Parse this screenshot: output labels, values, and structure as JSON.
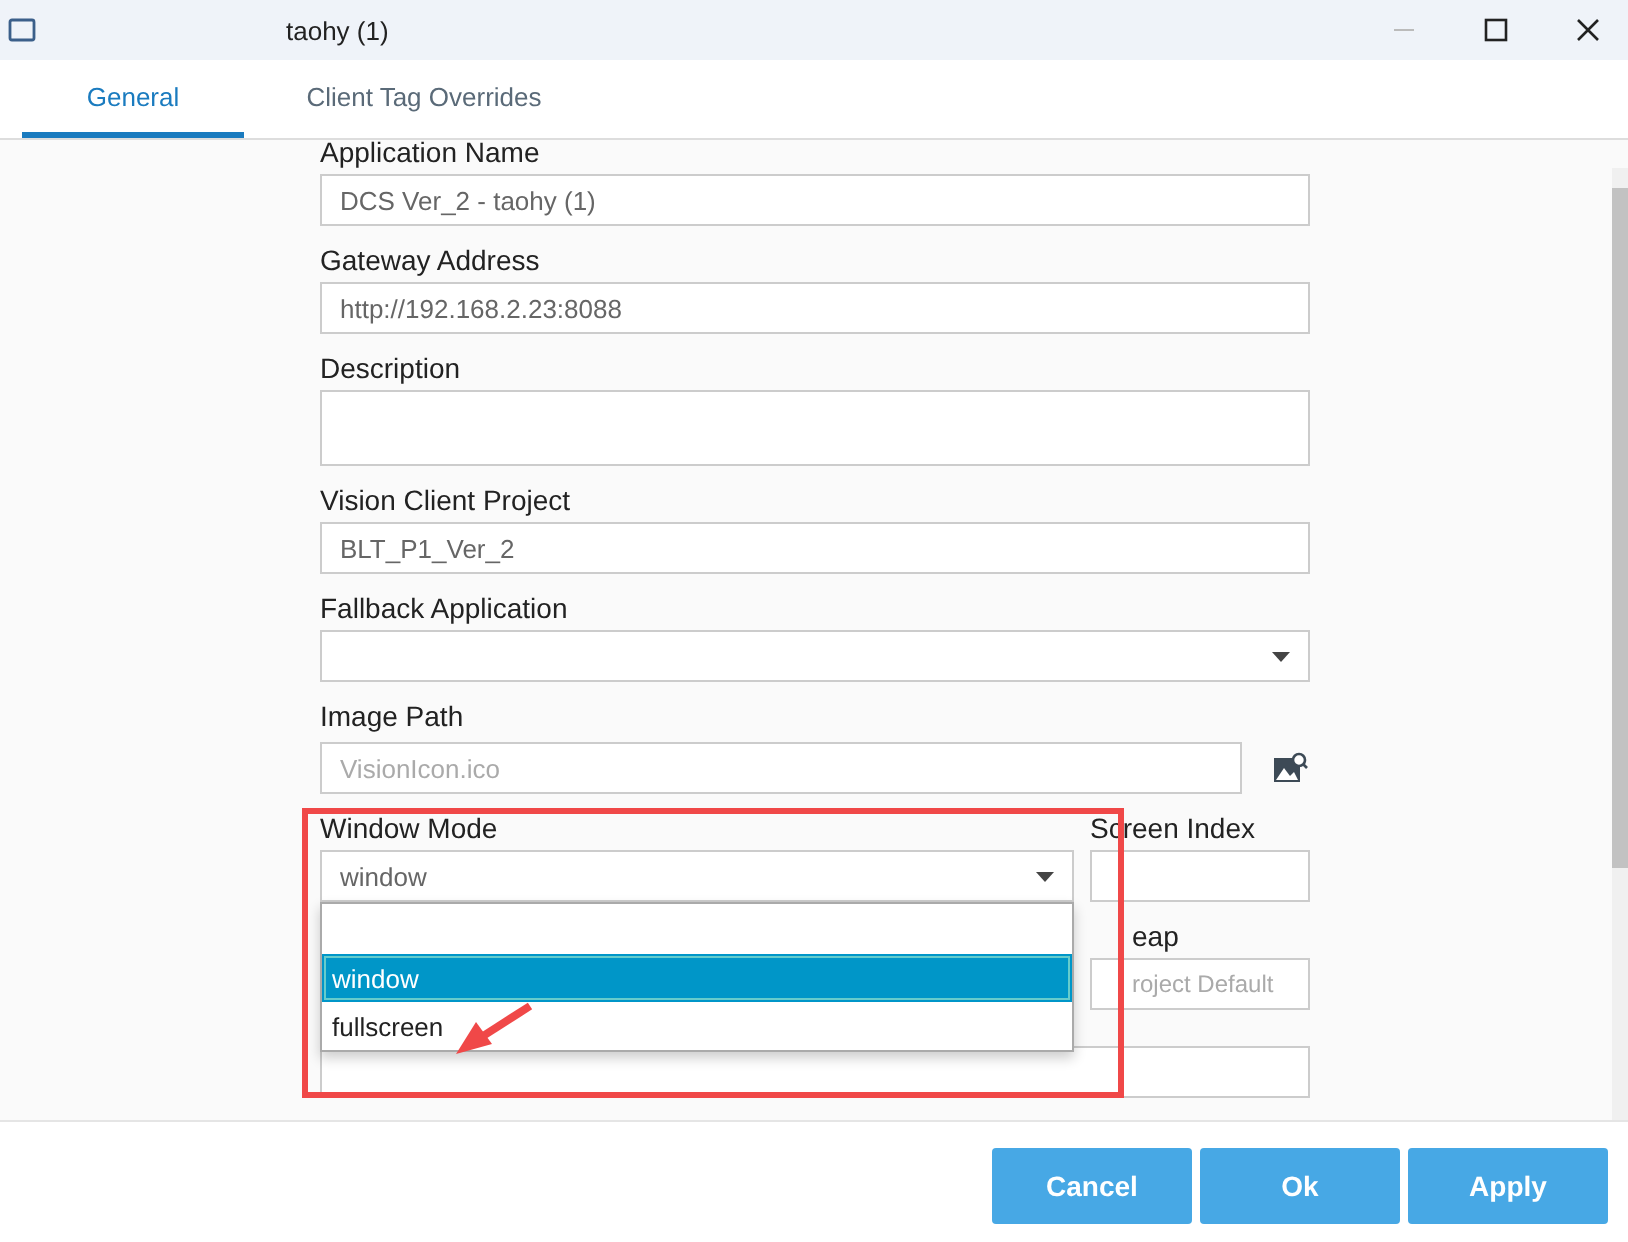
{
  "window": {
    "title": "taohy (1)"
  },
  "tabs": [
    {
      "label": "General",
      "selected": true
    },
    {
      "label": "Client Tag Overrides",
      "selected": false
    }
  ],
  "fields": [
    {
      "kind": "text",
      "label": "Application Name",
      "value": "DCS Ver_2 - taohy (1)"
    },
    {
      "kind": "text",
      "label": "Gateway Address",
      "value": "http://192.168.2.23:8088"
    },
    {
      "kind": "textarea",
      "label": "Description"
    },
    {
      "kind": "text",
      "label": "Vision Client Project",
      "value": "BLT_P1_Ver_2"
    },
    {
      "kind": "select",
      "label": "Fallback Application"
    },
    {
      "kind": "file",
      "label": "Image Path",
      "placeholder": "VisionIcon.ico"
    }
  ],
  "window_mode": {
    "label": "Window Mode",
    "value": "window",
    "expanded": true,
    "options": [
      {
        "label": "window",
        "selected": true
      },
      {
        "label": "fullscreen",
        "selected": false
      }
    ]
  },
  "screen_index": {
    "label": "Screen Index"
  },
  "partial_field": {
    "label": "eap",
    "placeholder": "roject Default"
  },
  "buttons": [
    "Cancel",
    "Ok",
    "Apply"
  ]
}
